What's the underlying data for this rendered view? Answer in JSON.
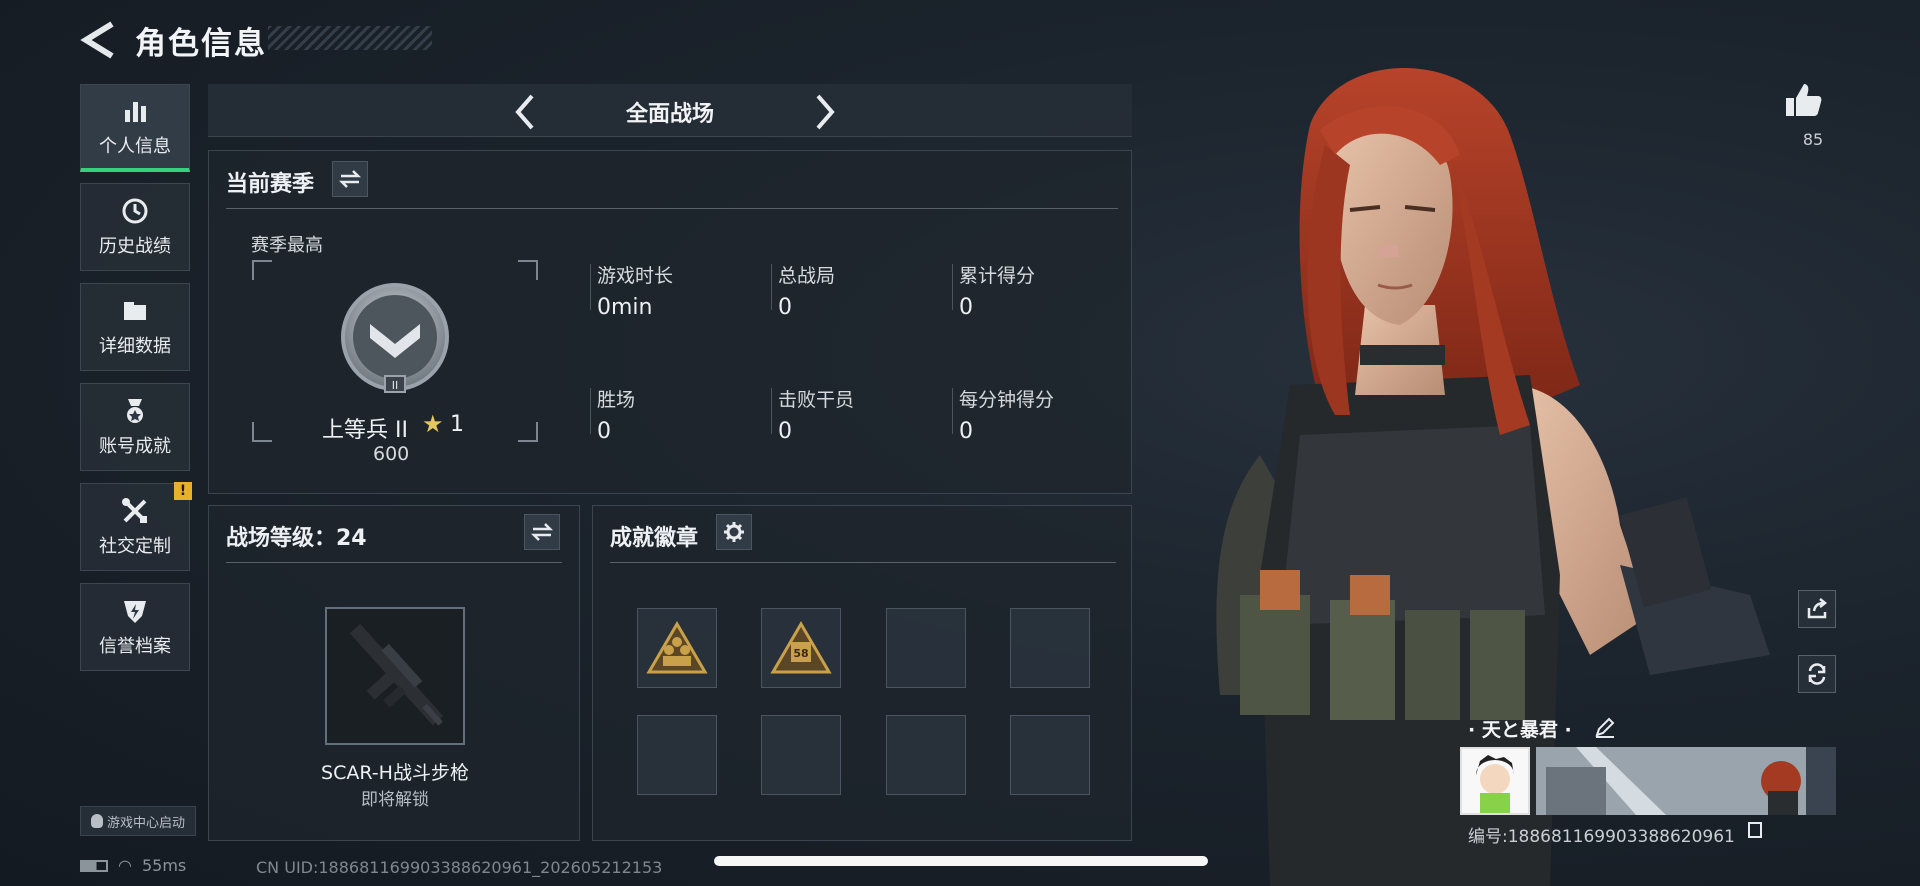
{
  "header": {
    "title": "角色信息"
  },
  "sidebar": {
    "items": [
      {
        "label": "个人信息",
        "icon": "bar-chart-icon"
      },
      {
        "label": "历史战绩",
        "icon": "history-clock-icon"
      },
      {
        "label": "详细数据",
        "icon": "folder-icon"
      },
      {
        "label": "账号成就",
        "icon": "medal-icon"
      },
      {
        "label": "社交定制",
        "icon": "tools-icon"
      },
      {
        "label": "信誉档案",
        "icon": "shield-icon"
      }
    ],
    "alert": "!",
    "launch_label": "游戏中心启动"
  },
  "mode": {
    "title": "全面战场"
  },
  "season": {
    "title": "当前赛季",
    "best_label": "赛季最高",
    "rank_name": "上等兵 II",
    "rank_stars": "1",
    "rank_points": "600",
    "rank_emblem_numeral": "II",
    "stats": [
      {
        "label": "游戏时长",
        "value": "0min"
      },
      {
        "label": "总战局",
        "value": "0"
      },
      {
        "label": "累计得分",
        "value": "0"
      },
      {
        "label": "胜场",
        "value": "0"
      },
      {
        "label": "击败干员",
        "value": "0"
      },
      {
        "label": "每分钟得分",
        "value": "0"
      }
    ]
  },
  "level": {
    "title": "战场等级：24",
    "weapon_name": "SCAR-H战斗步枪",
    "weapon_status": "即将解锁"
  },
  "badges": {
    "title": "成就徽章",
    "slot_58_label": "58"
  },
  "profile": {
    "likes": "85",
    "name": "· 天と暴君 ·",
    "uid": "编号:1886811699033886209​61"
  },
  "status": {
    "ping": "55ms",
    "cn_uid": "CN UID:1886811699033886209​61_202605212153"
  },
  "colors": {
    "accent": "#36d07f",
    "alert": "#e6b12b",
    "badge_gold": "#c9a14a"
  }
}
